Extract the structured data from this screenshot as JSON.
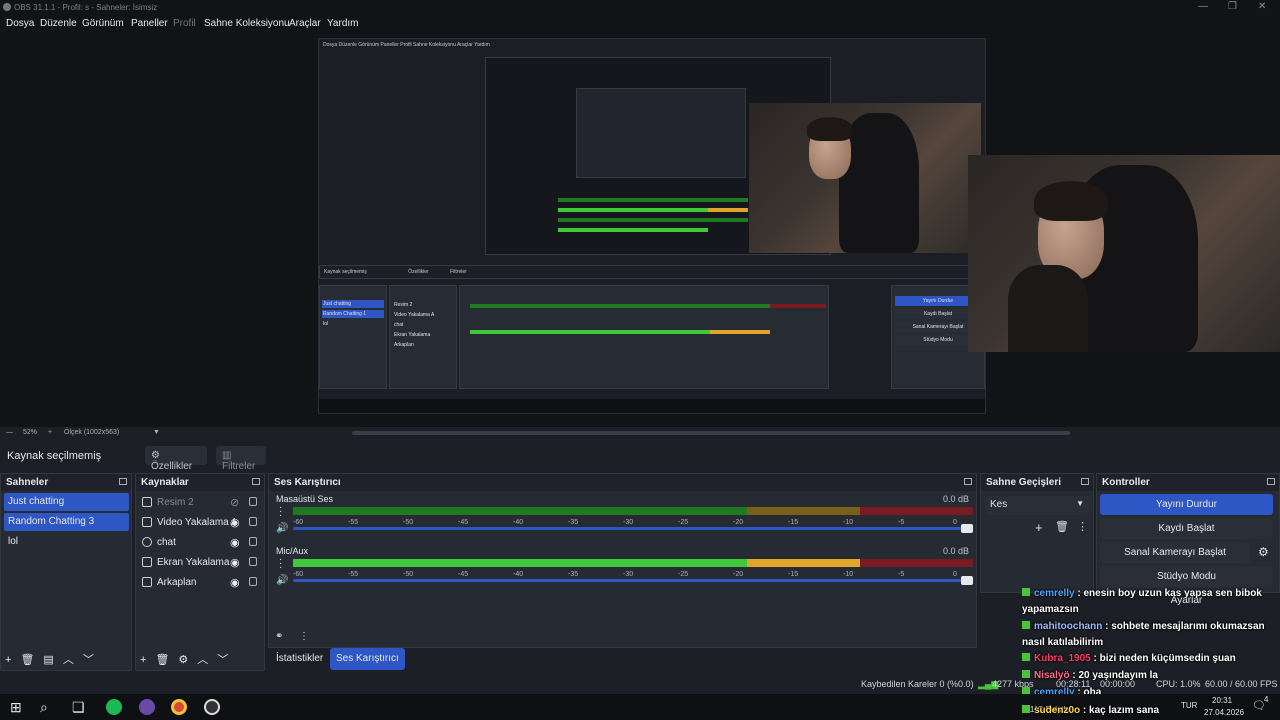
{
  "window": {
    "title": "OBS 31.1.1 - Profil: s - Sahneler: İsimsiz"
  },
  "menu": [
    "Dosya",
    "Düzenle",
    "Görünüm",
    "Paneller",
    "Profil",
    "Sahne Koleksiyonu",
    "Araçlar",
    "Yardım"
  ],
  "preview": {
    "inner_menu": "Dosya Düzenle Görünüm Paneller Profil Sahne Koleksiyonu Araçlar Yardım",
    "inner_source": "Kaynak seçilmemiş",
    "inner_props": "Özellikler",
    "inner_filters": "Filtreler",
    "inner_scenes": [
      "Just chatting",
      "Random Chatting 1",
      "lol"
    ],
    "inner_sources": [
      "Resim 2",
      "Video Yakalama A",
      "chat",
      "Ekran Yakalama",
      "Arkaplan"
    ],
    "inner_controls": [
      "Yayını Durdur",
      "Kaydı Başlat",
      "Sanal Kamerayı Başlat",
      "Stüdyo Modu"
    ]
  },
  "zoom": {
    "percent": "52%",
    "scale": "Ölçek (1002x563)"
  },
  "source_bar": {
    "label": "Kaynak seçilmemiş",
    "properties": "Özellikler",
    "filters": "Filtreler"
  },
  "scenes": {
    "title": "Sahneler",
    "items": [
      {
        "label": "Just chatting",
        "selected": true
      },
      {
        "label": "Random Chatting 3",
        "selected": true
      },
      {
        "label": "lol",
        "selected": false
      }
    ]
  },
  "sources": {
    "title": "Kaynaklar",
    "items": [
      {
        "label": "Resim 2",
        "visible": false
      },
      {
        "label": "Video Yakalama A",
        "visible": true
      },
      {
        "label": "chat",
        "visible": true
      },
      {
        "label": "Ekran Yakalama",
        "visible": true
      },
      {
        "label": "Arkaplan",
        "visible": true
      }
    ]
  },
  "mixer": {
    "title": "Ses Karıştırıcı",
    "channels": [
      {
        "name": "Masaüstü Ses",
        "db": "0.0 dB",
        "volume": 1.0
      },
      {
        "name": "Mic/Aux",
        "db": "0.0 dB",
        "volume": 1.0
      }
    ],
    "ticks": [
      "-60",
      "-55",
      "-50",
      "-45",
      "-40",
      "-35",
      "-30",
      "-25",
      "-20",
      "-15",
      "-10",
      "-5",
      "0"
    ],
    "tabs": [
      "İstatistikler",
      "Ses Karıştırıcı"
    ]
  },
  "transitions": {
    "title": "Sahne Geçişleri",
    "selected": "Kes"
  },
  "controls": {
    "title": "Kontroller",
    "buttons": [
      "Yayını Durdur",
      "Kaydı Başlat",
      "Sanal Kamerayı Başlat",
      "Stüdyo Modu",
      "Ayarlar"
    ]
  },
  "chat": [
    {
      "user": "cemrelly",
      "user_color": "#4aa3ff",
      "text": ": enesin boy uzun kas yapsa sen bibok yapamazsın"
    },
    {
      "user": "mahitoochann",
      "user_color": "#9ab8ff",
      "text": ": sohbete mesajlarımı okumazsan nasıl katılabilirim"
    },
    {
      "user": "Kubra_1905",
      "user_color": "#ff3a6e",
      "text": ": bizi neden küçümsedin şuan"
    },
    {
      "user": "Nisalyö",
      "user_color": "#ff6a8a",
      "text": ": 20 yaşındayım la"
    },
    {
      "user": "cemrelly",
      "user_color": "#4aa3ff",
      "text": ": oha"
    },
    {
      "user": "sudenz0o",
      "user_color": "#ffd84a",
      "text": ": kaç lazım sana"
    }
  ],
  "status": {
    "dropped": "Kaybedilen Kareler 0 (%0.0)",
    "kbps": "4277 kbps",
    "live_time": "00:28:11",
    "rec_time": "00:00:00",
    "cpu": "CPU: 1.0%",
    "fps": "60.00 / 60.00 FPS"
  },
  "taskbar": {
    "weather": "11°C Bulutlu",
    "lang": "TUR",
    "time": "20:31",
    "date": "27.04.2026",
    "notif": "4"
  },
  "colors": {
    "accent": "#2f56c5",
    "panel": "#262a32",
    "bg": "#1d1f26"
  }
}
